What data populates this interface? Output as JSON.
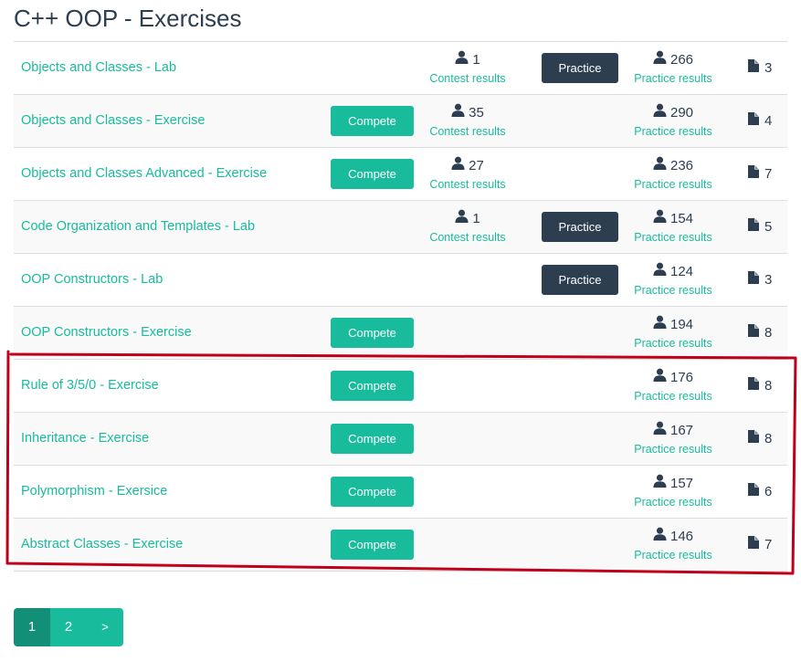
{
  "page": {
    "title": "C++ OOP - Exercises"
  },
  "colors": {
    "accent": "#18bc9c",
    "dark": "#2c3e50",
    "highlight": "#c0001a"
  },
  "labels": {
    "compete": "Compete",
    "practice": "Practice",
    "contest_results": "Contest results",
    "practice_results": "Practice results"
  },
  "rows": [
    {
      "title": "Objects and Classes - Lab",
      "compete": false,
      "contest_count": "1",
      "practice": true,
      "practice_count": "266",
      "docs": "3"
    },
    {
      "title": "Objects and Classes - Exercise",
      "compete": true,
      "contest_count": "35",
      "practice": false,
      "practice_count": "290",
      "docs": "4"
    },
    {
      "title": "Objects and Classes Advanced - Exercise",
      "compete": true,
      "contest_count": "27",
      "practice": false,
      "practice_count": "236",
      "docs": "7"
    },
    {
      "title": "Code Organization and Templates - Lab",
      "compete": false,
      "contest_count": "1",
      "practice": true,
      "practice_count": "154",
      "docs": "5"
    },
    {
      "title": "OOP Constructors - Lab",
      "compete": false,
      "contest_count": null,
      "practice": true,
      "practice_count": "124",
      "docs": "3"
    },
    {
      "title": "OOP Constructors - Exercise",
      "compete": true,
      "contest_count": null,
      "practice": false,
      "practice_count": "194",
      "docs": "8"
    },
    {
      "title": "Rule of 3/5/0 - Exercise",
      "compete": true,
      "contest_count": null,
      "practice": false,
      "practice_count": "176",
      "docs": "8"
    },
    {
      "title": "Inheritance - Exercise",
      "compete": true,
      "contest_count": null,
      "practice": false,
      "practice_count": "167",
      "docs": "8"
    },
    {
      "title": "Polymorphism - Exersice",
      "compete": true,
      "contest_count": null,
      "practice": false,
      "practice_count": "157",
      "docs": "6"
    },
    {
      "title": "Abstract Classes - Exercise",
      "compete": true,
      "contest_count": null,
      "practice": false,
      "practice_count": "146",
      "docs": "7"
    }
  ],
  "pagination": {
    "pages": [
      "1",
      "2"
    ],
    "active": "1",
    "next": ">"
  }
}
